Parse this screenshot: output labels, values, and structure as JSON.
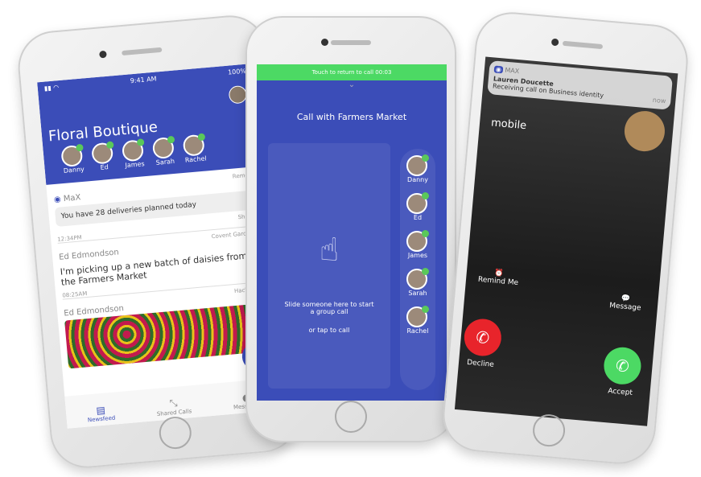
{
  "phone1": {
    "status": {
      "time": "9:41 AM",
      "battery": "100%"
    },
    "title": "Floral Boutique",
    "contacts": [
      "Danny",
      "Ed",
      "James",
      "Sarah",
      "Rachel"
    ],
    "remove": "Remove",
    "max_label": "MaX",
    "max_card": "You have 28 deliveries planned today",
    "card_source": "Shopify",
    "time1": "12:34PM",
    "loc1": "Covent Garden",
    "author1": "Ed Edmondson",
    "post1": "I'm picking up a new batch of daisies from the Farmers Market",
    "time2": "08:25AM",
    "loc2": "Hackney",
    "author2": "Ed Edmondson",
    "tabs": [
      "Newsfeed",
      "Shared Calls",
      "Messages"
    ],
    "fab": "+"
  },
  "phone2": {
    "banner": "Touch to return to call 00:03",
    "title": "Call with Farmers Market",
    "hint1": "Slide someone here to start a group call",
    "hint2": "or tap to call",
    "contacts": [
      "Danny",
      "Ed",
      "James",
      "Sarah",
      "Rachel"
    ]
  },
  "phone3": {
    "app": "MAX",
    "caller": "Lauren Doucette",
    "message": "Receiving call on Business identity",
    "time": "now",
    "line": "mobile",
    "remind": "Remind Me",
    "msg": "Message",
    "decline": "Decline",
    "accept": "Accept"
  },
  "colors": {
    "brand": "#3b4db8",
    "green": "#4cd964",
    "red": "#e8242b"
  }
}
